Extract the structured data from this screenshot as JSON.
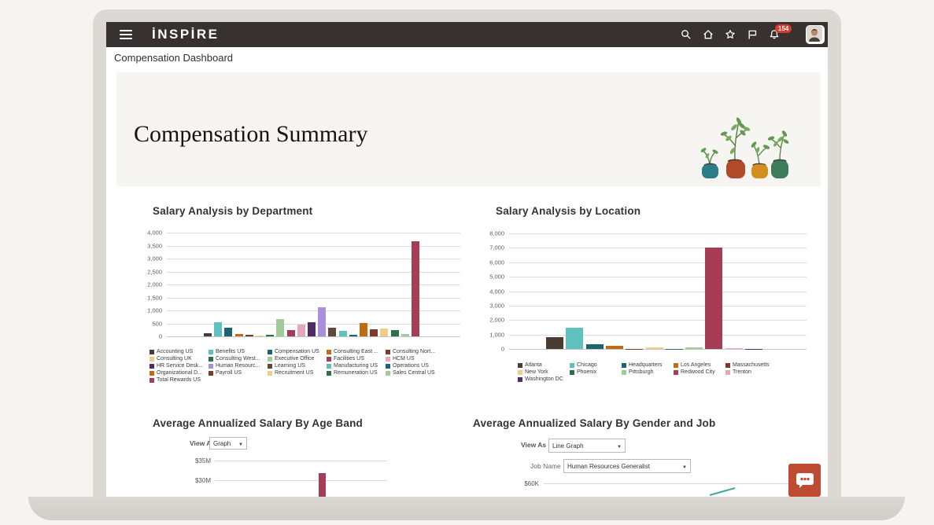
{
  "header": {
    "logo": "İNSPİRE",
    "notification_count": "154"
  },
  "page": {
    "title": "Compensation Dashboard"
  },
  "banner": {
    "title": "Compensation Summary"
  },
  "chart_data": [
    {
      "type": "bar",
      "title": "Salary Analysis by Department",
      "ylim": [
        0,
        4000
      ],
      "yticks": [
        "4,000",
        "3,500",
        "3,000",
        "2,500",
        "2,000",
        "1,500",
        "1,000",
        "500",
        "0"
      ],
      "categories": [
        "Accounting US",
        "Benefits US",
        "Compensation US",
        "Consulting East ...",
        "Consulting Nort...",
        "Consulting UK",
        "Consulting West...",
        "Executive Office",
        "Facilities US",
        "HCM US",
        "HR Service Desk...",
        "Human Resourc...",
        "Learning US",
        "Manufacturing US",
        "Operations US",
        "Organizational D...",
        "Payroll US",
        "Recruitment US",
        "Remuneration US",
        "Sales Central US",
        "Total Rewards US"
      ],
      "values": [
        120,
        560,
        340,
        90,
        60,
        30,
        70,
        680,
        250,
        450,
        540,
        1110,
        350,
        200,
        50,
        530,
        270,
        310,
        230,
        90,
        3670
      ],
      "colors": [
        "#4a3c33",
        "#5fc0c0",
        "#1c6470",
        "#c06c10",
        "#7b3b2a",
        "#f2cd8a",
        "#2e6e4e",
        "#9fcc97",
        "#a63d56",
        "#e3a8bc",
        "#4e2d66",
        "#a98fdc",
        "#5d4a38",
        "#5fc0c0",
        "#1c6470",
        "#c06c10",
        "#7b3b2a",
        "#f2cd8a",
        "#2e6e4e",
        "#9fcc97",
        "#a63d56"
      ],
      "legend_position": "bottom",
      "grid": true
    },
    {
      "type": "bar",
      "title": "Salary Analysis by Location",
      "ylim": [
        0,
        8000
      ],
      "yticks": [
        "8,000",
        "7,000",
        "6,000",
        "5,000",
        "4,000",
        "3,000",
        "2,000",
        "1,000",
        "0"
      ],
      "categories": [
        "Atlanta",
        "Chicago",
        "Headquarters",
        "Los Angeles",
        "Massachusetts",
        "New York",
        "Phoenix",
        "Pittsburgh",
        "Redwood City",
        "Trenton",
        "Washington DC"
      ],
      "values": [
        830,
        1450,
        320,
        230,
        20,
        120,
        20,
        100,
        7000,
        50,
        15
      ],
      "colors": [
        "#4a3c33",
        "#5fc0c0",
        "#1c6470",
        "#c06c10",
        "#7b3b2a",
        "#f2cd8a",
        "#2e6e4e",
        "#9fcc97",
        "#a63d56",
        "#e3a8bc",
        "#4e2d66"
      ],
      "legend_position": "bottom",
      "grid": true
    },
    {
      "type": "bar",
      "title": "Average Annualized Salary By Age Band",
      "view_as_label": "View As",
      "view_as_value": "Graph",
      "yticks_visible": [
        "$35M",
        "$30M"
      ],
      "visible_bar_value_musd": 32,
      "bar_color": "#a63d56"
    },
    {
      "type": "line",
      "title": "Average Annualized Salary By Gender and Job",
      "view_as_label": "View As",
      "view_as_value": "Line Graph",
      "job_name_label": "Job Name",
      "job_name_value": "Human Resources Generalist",
      "yticks_visible": [
        "$60K"
      ],
      "line_color": "#3fa9a5"
    }
  ]
}
